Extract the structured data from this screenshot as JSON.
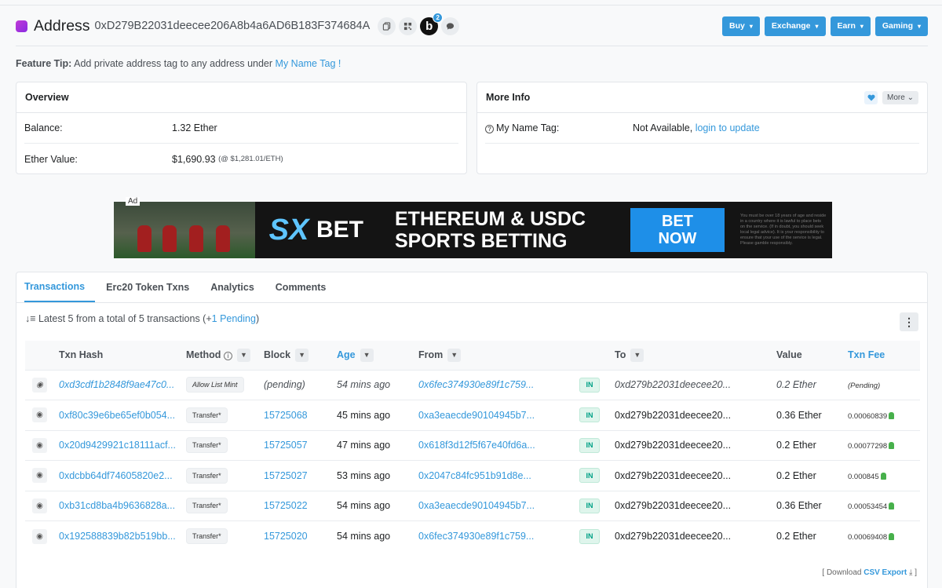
{
  "header": {
    "title": "Address",
    "address": "0xD279B22031deecee206A8b4a6AD6B183F374684A",
    "b_label": "b",
    "b_badge": "2",
    "menu": [
      "Buy",
      "Exchange",
      "Earn",
      "Gaming"
    ]
  },
  "tip": {
    "label": "Feature Tip:",
    "text": "Add private address tag to any address under",
    "link": "My Name Tag",
    "end": "!"
  },
  "overview": {
    "title": "Overview",
    "balance_label": "Balance:",
    "balance_value": "1.32 Ether",
    "value_label": "Ether Value:",
    "value_value": "$1,690.93",
    "value_rate": "(@ $1,281.01/ETH)"
  },
  "more_info": {
    "title": "More Info",
    "more_btn": "More",
    "name_tag_label": "My Name Tag:",
    "name_tag_value": "Not Available,",
    "name_tag_link": "login to update"
  },
  "ad": {
    "label": "Ad",
    "brand": "SX",
    "bet": "BET",
    "line1": "ETHEREUM & USDC",
    "line2": "SPORTS BETTING",
    "cta1": "BET",
    "cta2": "NOW",
    "fine": "You must be over 18 years of age and reside in a country where it is lawful to place bets on the service. (If in doubt, you should seek local legal advice). It is your responsibility to ensure that your use of the service is legal. Please gamble responsibly."
  },
  "tabs": [
    "Transactions",
    "Erc20 Token Txns",
    "Analytics",
    "Comments"
  ],
  "summary": {
    "text": "Latest 5 from a total of 5 transactions (+",
    "pending_link": "1 Pending",
    "end": ")"
  },
  "columns": [
    "Txn Hash",
    "Method",
    "Block",
    "Age",
    "From",
    "To",
    "Value",
    "Txn Fee"
  ],
  "rows": [
    {
      "hash": "0xd3cdf1b2848f9ae47c0...",
      "method": "Allow List Mint",
      "block": "(pending)",
      "age": "54 mins ago",
      "from": "0x6fec374930e89f1c759...",
      "dir": "IN",
      "to": "0xd279b22031deecee20...",
      "value": "0.2 Ether",
      "fee": "(Pending)"
    },
    {
      "hash": "0xf80c39e6be65ef0b054...",
      "method": "Transfer*",
      "block": "15725068",
      "age": "45 mins ago",
      "from": "0xa3eaecde90104945b7...",
      "dir": "IN",
      "to": "0xd279b22031deecee20...",
      "value": "0.36 Ether",
      "fee": "0.00060839"
    },
    {
      "hash": "0x20d9429921c18111acf...",
      "method": "Transfer*",
      "block": "15725057",
      "age": "47 mins ago",
      "from": "0x618f3d12f5f67e40fd6a...",
      "dir": "IN",
      "to": "0xd279b22031deecee20...",
      "value": "0.2 Ether",
      "fee": "0.00077298"
    },
    {
      "hash": "0xdcbb64df74605820e2...",
      "method": "Transfer*",
      "block": "15725027",
      "age": "53 mins ago",
      "from": "0x2047c84fc951b91d8e...",
      "dir": "IN",
      "to": "0xd279b22031deecee20...",
      "value": "0.2 Ether",
      "fee": "0.000845"
    },
    {
      "hash": "0xb31cd8ba4b9636828a...",
      "method": "Transfer*",
      "block": "15725022",
      "age": "54 mins ago",
      "from": "0xa3eaecde90104945b7...",
      "dir": "IN",
      "to": "0xd279b22031deecee20...",
      "value": "0.36 Ether",
      "fee": "0.00053454"
    },
    {
      "hash": "0x192588839b82b519bb...",
      "method": "Transfer*",
      "block": "15725020",
      "age": "54 mins ago",
      "from": "0x6fec374930e89f1c759...",
      "dir": "IN",
      "to": "0xd279b22031deecee20...",
      "value": "0.2 Ether",
      "fee": "0.00069408"
    }
  ],
  "footer": {
    "open": "[ Download",
    "link": "CSV Export",
    "close": "]"
  },
  "colors": {
    "accent": "#3498db",
    "in_badge": "#00a186",
    "gas": "#47b04b"
  },
  "icons": [
    "copy-icon",
    "qr-code-icon",
    "blockscan-chat-icon",
    "comment-icon",
    "heart-icon",
    "sort-icon",
    "filter-icon",
    "eye-icon",
    "info-icon",
    "question-icon",
    "download-icon",
    "gas-icon"
  ]
}
